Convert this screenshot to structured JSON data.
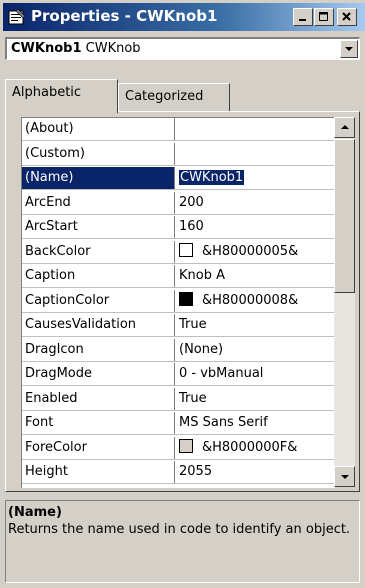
{
  "window": {
    "title": "Properties - CWKnob1"
  },
  "object_selector": {
    "name": "CWKnob1",
    "type": "CWKnob"
  },
  "tabs": [
    {
      "label": "Alphabetic",
      "active": true
    },
    {
      "label": "Categorized",
      "active": false
    }
  ],
  "properties": [
    {
      "name": "(About)",
      "value": ""
    },
    {
      "name": "(Custom)",
      "value": ""
    },
    {
      "name": "(Name)",
      "value": "CWKnob1",
      "selected": true
    },
    {
      "name": "ArcEnd",
      "value": "200"
    },
    {
      "name": "ArcStart",
      "value": "160"
    },
    {
      "name": "BackColor",
      "value": "&H80000005&",
      "swatch": "#ffffff"
    },
    {
      "name": "Caption",
      "value": "Knob A"
    },
    {
      "name": "CaptionColor",
      "value": "&H80000008&",
      "swatch": "#000000"
    },
    {
      "name": "CausesValidation",
      "value": "True"
    },
    {
      "name": "DragIcon",
      "value": "(None)"
    },
    {
      "name": "DragMode",
      "value": "0 - vbManual"
    },
    {
      "name": "Enabled",
      "value": "True"
    },
    {
      "name": "Font",
      "value": "MS Sans Serif"
    },
    {
      "name": "ForeColor",
      "value": "&H8000000F&",
      "swatch": "#d4d0c8"
    },
    {
      "name": "Height",
      "value": "2055"
    }
  ],
  "description": {
    "title": "(Name)",
    "text": "Returns the name used in code to identify an object."
  },
  "colors": {
    "titlebar": "#0a246a",
    "selection": "#0a246a",
    "face": "#d4d0c8"
  }
}
